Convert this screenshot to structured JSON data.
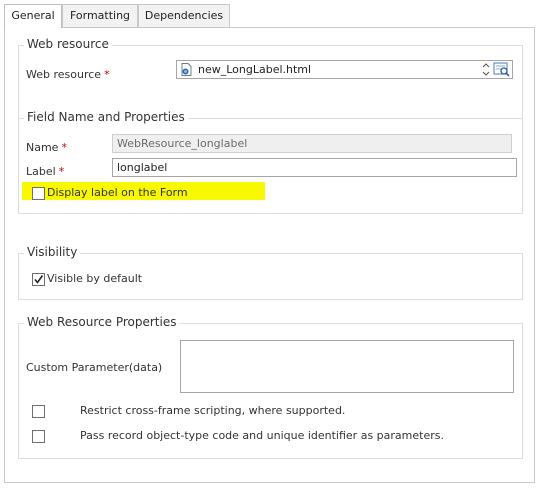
{
  "tabs": [
    {
      "label": "General",
      "active": true
    },
    {
      "label": "Formatting",
      "active": false
    },
    {
      "label": "Dependencies",
      "active": false
    }
  ],
  "web_resource_section": {
    "title": "Web resource",
    "field_label": "Web resource",
    "required_mark": "*",
    "value": "new_LongLabel.html",
    "icons": [
      "document-icon",
      "spinner-arrows-icon",
      "lookup-icon"
    ]
  },
  "field_name_section": {
    "title": "Field Name and Properties",
    "name_label": "Name",
    "name_value": "WebResource_longlabel",
    "label_label": "Label",
    "label_value": "longlabel",
    "required_mark": "*",
    "display_label_checkbox": {
      "label": "Display label on the Form",
      "checked": false
    }
  },
  "visibility_section": {
    "title": "Visibility",
    "visible_checkbox": {
      "label": "Visible by default",
      "checked": true
    }
  },
  "web_resource_properties": {
    "title": "Web Resource Properties",
    "custom_parameter_label": "Custom Parameter(data)",
    "custom_parameter_value": "",
    "restrict_checkbox": {
      "label": "Restrict cross-frame scripting, where supported.",
      "checked": false
    },
    "pass_record_checkbox": {
      "label": "Pass record object-type code and unique identifier as parameters.",
      "checked": false
    }
  },
  "colors": {
    "highlight": "#f8f800",
    "required": "#c00000"
  }
}
